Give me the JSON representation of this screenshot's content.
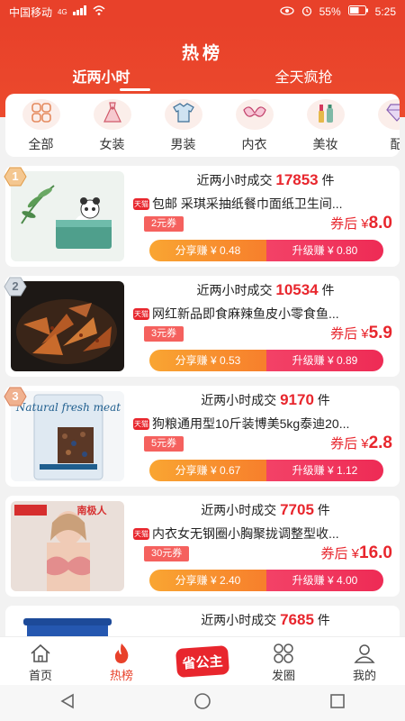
{
  "status_bar": {
    "carrier": "中国移动",
    "network": "4G",
    "battery": "55%",
    "time": "5:25"
  },
  "header": {
    "title": "热榜",
    "tabs": [
      {
        "label": "近两小时"
      },
      {
        "label": "全天疯抢"
      }
    ]
  },
  "categories": [
    {
      "label": "全部",
      "icon": "grid-icon"
    },
    {
      "label": "女装",
      "icon": "dress-icon"
    },
    {
      "label": "男装",
      "icon": "shirt-icon"
    },
    {
      "label": "内衣",
      "icon": "bra-icon"
    },
    {
      "label": "美妆",
      "icon": "cosmetics-icon"
    },
    {
      "label": "配",
      "icon": "diamond-icon"
    }
  ],
  "products": [
    {
      "rank": "1",
      "sold_prefix": "近两小时成交",
      "sold_count": "17853",
      "sold_unit": "件",
      "title": "包邮 采琪采抽纸餐巾面纸卫生间...",
      "coupon": "2元券",
      "price_label": "券后 ¥",
      "price": "8.0",
      "share": "分享赚 ¥ 0.48",
      "upgrade": "升级赚 ¥ 0.80",
      "shop_badge": "天猫"
    },
    {
      "rank": "2",
      "sold_prefix": "近两小时成交",
      "sold_count": "10534",
      "sold_unit": "件",
      "title": "网红新品即食麻辣鱼皮小零食鱼...",
      "coupon": "3元券",
      "price_label": "券后 ¥",
      "price": "5.9",
      "share": "分享赚 ¥ 0.53",
      "upgrade": "升级赚 ¥ 0.89",
      "shop_badge": "天猫"
    },
    {
      "rank": "3",
      "sold_prefix": "近两小时成交",
      "sold_count": "9170",
      "sold_unit": "件",
      "title": "狗粮通用型10斤装博美5kg泰迪20...",
      "coupon": "5元券",
      "price_label": "券后 ¥",
      "price": "2.8",
      "share": "分享赚 ¥ 0.67",
      "upgrade": "升级赚 ¥ 1.12",
      "shop_badge": "天猫",
      "thumb_text": "Natural fresh meat"
    },
    {
      "rank": "",
      "sold_prefix": "近两小时成交",
      "sold_count": "7705",
      "sold_unit": "件",
      "title": "内衣女无钢圈小胸聚拢调整型收...",
      "coupon": "30元券",
      "price_label": "券后 ¥",
      "price": "16.0",
      "share": "分享赚 ¥ 2.40",
      "upgrade": "升级赚 ¥ 4.00",
      "shop_badge": "天猫",
      "thumb_text": "南极人"
    },
    {
      "rank": "",
      "sold_prefix": "近两小时成交",
      "sold_count": "7685",
      "sold_unit": "件"
    }
  ],
  "bottom_nav": [
    {
      "label": "首页"
    },
    {
      "label": "热榜"
    },
    {
      "label": "省公主"
    },
    {
      "label": "发圈"
    },
    {
      "label": "我的"
    }
  ],
  "colors": {
    "brand_red": "#e8412a",
    "price_red": "#e8262d",
    "share_orange": "#f9a532",
    "upgrade_pink": "#f34267"
  }
}
